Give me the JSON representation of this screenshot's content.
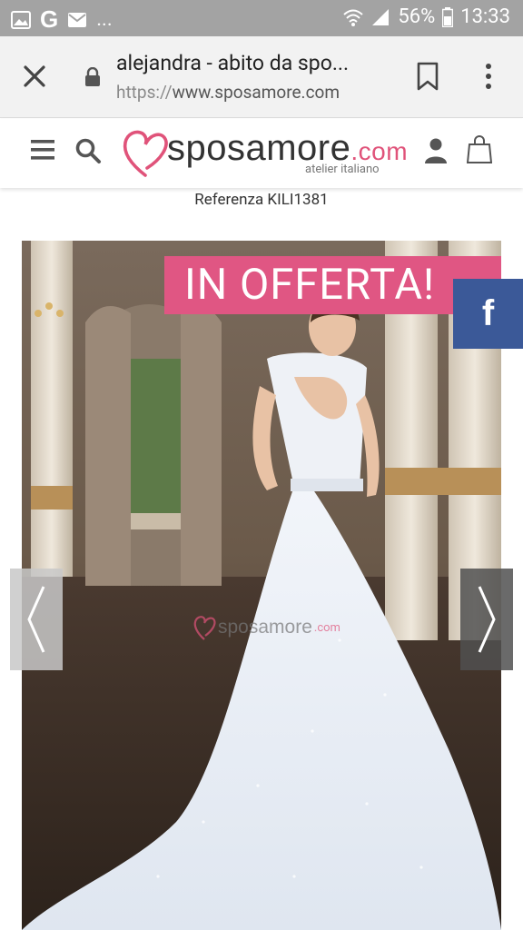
{
  "status_bar": {
    "overflow": "...",
    "battery": "56%",
    "time": "13:33",
    "icons": [
      "gallery-icon",
      "google-icon",
      "mail-icon",
      "wifi-icon",
      "signal-icon",
      "battery-icon"
    ]
  },
  "browser": {
    "tab_title": "alejandra - abito da spo...",
    "url_scheme": "https://",
    "url_host": "www.sposamore.com"
  },
  "site": {
    "brand": "sposamore",
    "brand_tld": ".com",
    "tagline": "atelier italiano",
    "accent_color": "#e0537a"
  },
  "product": {
    "reference": "Referenza KILI1381",
    "offer_label": "IN OFFERTA!",
    "watermark": "sposamore",
    "watermark_tld": ".com"
  },
  "social": {
    "facebook_label": "f",
    "facebook_color": "#3b5998"
  }
}
